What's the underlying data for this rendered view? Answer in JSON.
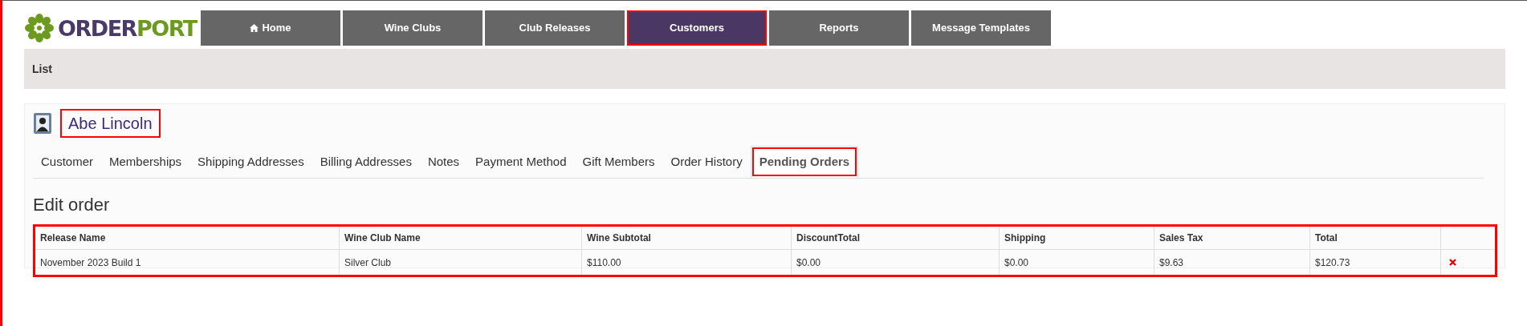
{
  "logo": {
    "part_1": "ORDER",
    "part_2": "PORT"
  },
  "nav": [
    {
      "label": "Home",
      "selected": false,
      "highlighted": false
    },
    {
      "label": "Wine Clubs",
      "selected": false,
      "highlighted": false
    },
    {
      "label": "Club Releases",
      "selected": false,
      "highlighted": false
    },
    {
      "label": "Customers",
      "selected": true,
      "highlighted": true
    },
    {
      "label": "Reports",
      "selected": false,
      "highlighted": false
    },
    {
      "label": "Message Templates",
      "selected": false,
      "highlighted": false
    }
  ],
  "breadcrumb": "List",
  "customer": {
    "name": "Abe Lincoln",
    "highlighted": true
  },
  "tabs": [
    {
      "label": "Customer",
      "selected": false,
      "highlighted": false
    },
    {
      "label": "Memberships",
      "selected": false,
      "highlighted": false
    },
    {
      "label": "Shipping Addresses",
      "selected": false,
      "highlighted": false
    },
    {
      "label": "Billing Addresses",
      "selected": false,
      "highlighted": false
    },
    {
      "label": "Notes",
      "selected": false,
      "highlighted": false
    },
    {
      "label": "Payment Method",
      "selected": false,
      "highlighted": false
    },
    {
      "label": "Gift Members",
      "selected": false,
      "highlighted": false
    },
    {
      "label": "Order History",
      "selected": false,
      "highlighted": false
    },
    {
      "label": "Pending Orders",
      "selected": true,
      "highlighted": true
    }
  ],
  "section_title": "Edit order",
  "table": {
    "highlighted": true,
    "columns": [
      "Release Name",
      "Wine Club Name",
      "Wine Subtotal",
      "DiscountTotal",
      "Shipping",
      "Sales Tax",
      "Total"
    ],
    "rows": [
      {
        "cells": [
          "November 2023 Build 1",
          "Silver Club",
          "$110.00",
          "$0.00",
          "$0.00",
          "$9.63",
          "$120.73"
        ],
        "deletable": true
      }
    ]
  }
}
